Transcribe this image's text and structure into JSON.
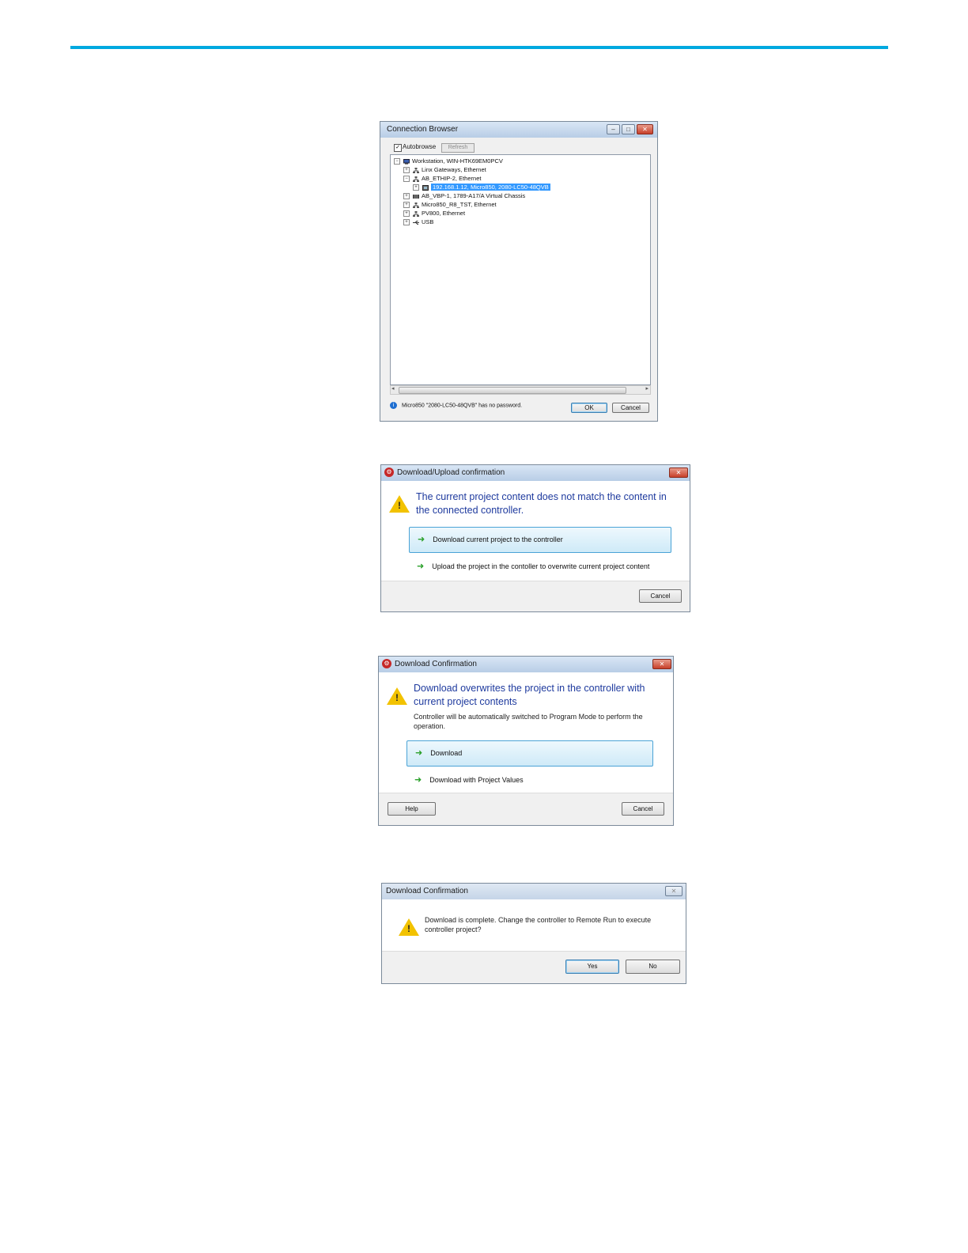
{
  "connection_browser": {
    "title": "Connection Browser",
    "autobrowse_label": "Autobrowse",
    "refresh_label": "Refresh",
    "tree": [
      {
        "label": "Workstation, WIN-HTK69EM0PCV",
        "icon": "computer-icon",
        "selected": false
      },
      {
        "label": "Linx Gateways, Ethernet",
        "icon": "network-icon",
        "selected": false
      },
      {
        "label": "AB_ETHIP-2, Ethernet",
        "icon": "network-icon",
        "selected": false
      },
      {
        "label": "192.168.1.12, Micro850, 2080-LC50-48QVB",
        "icon": "controller-icon",
        "selected": true
      },
      {
        "label": "AB_VBP-1, 1789-A17/A Virtual Chassis",
        "icon": "chassis-icon",
        "selected": false
      },
      {
        "label": "Micro850_R8_TST, Ethernet",
        "icon": "network-icon",
        "selected": false
      },
      {
        "label": "PV800, Ethernet",
        "icon": "network-icon",
        "selected": false
      },
      {
        "label": "USB",
        "icon": "usb-icon",
        "selected": false
      }
    ],
    "status_text": "Micro850 \"2080-LC50-48QVB\" has no password.",
    "ok_label": "OK",
    "cancel_label": "Cancel"
  },
  "download_upload": {
    "title": "Download/Upload confirmation",
    "main_instruction": "The current project content does not match the content in the connected controller.",
    "option1": "Download current project to the controller",
    "option2": "Upload the project in the contoller to overwrite current project content",
    "cancel_label": "Cancel"
  },
  "download_confirmation": {
    "title": "Download Confirmation",
    "main_instruction": "Download overwrites the project in the controller with current project contents",
    "content": "Controller will be automatically switched to Program Mode to perform the operation.",
    "option1": "Download",
    "option2": "Download with Project Values",
    "help_label": "Help",
    "cancel_label": "Cancel"
  },
  "remote_run": {
    "title": "Download Confirmation",
    "message": "Download is complete. Change the controller to Remote Run to execute controller project?",
    "yes_label": "Yes",
    "no_label": "No"
  },
  "colors": {
    "rule": "#00a9e0",
    "instruction": "#1e3a9e",
    "selection": "#3399ff"
  }
}
